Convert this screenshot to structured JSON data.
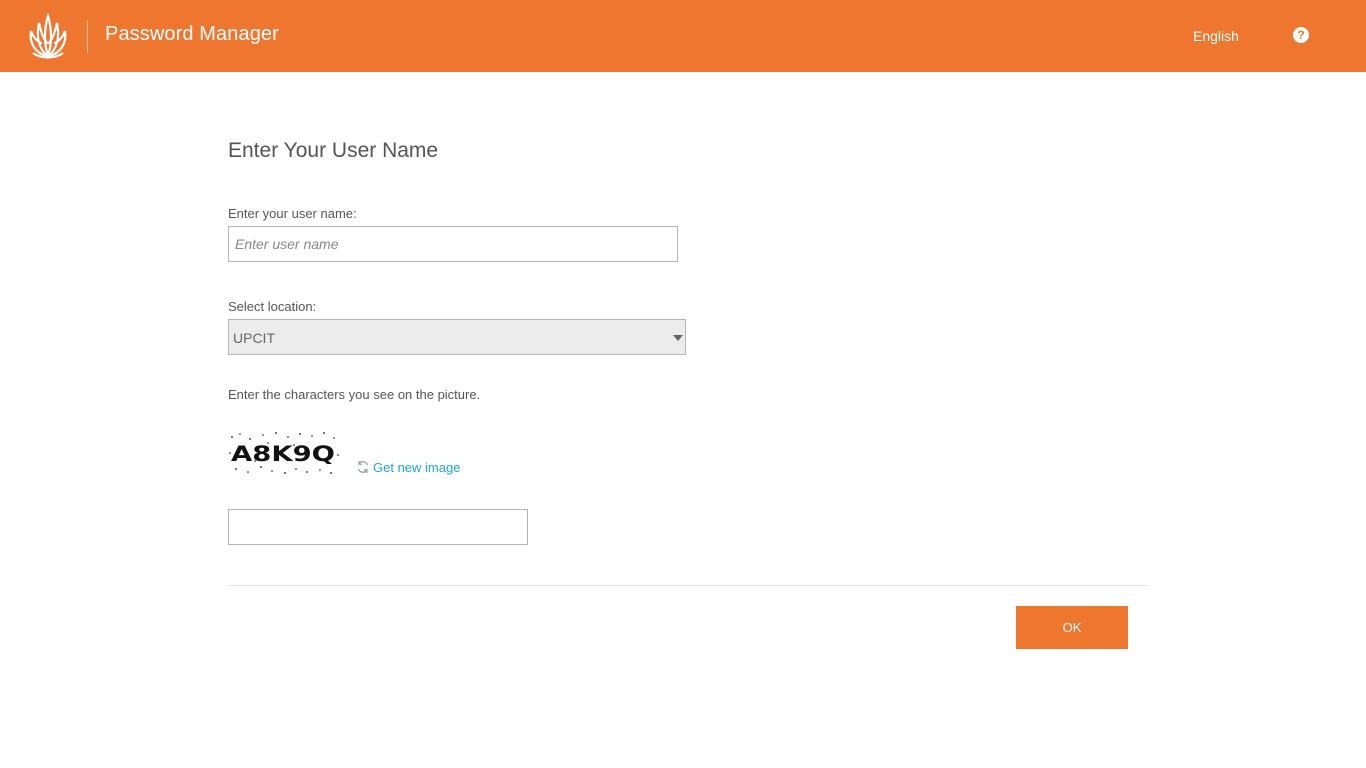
{
  "header": {
    "app_title": "Password Manager",
    "language": "English",
    "help_glyph": "?",
    "logo_icon": "company-logo-icon",
    "help_icon": "help-circle-icon",
    "background_color": "#ef762f"
  },
  "form": {
    "title": "Enter Your User Name",
    "username": {
      "label": "Enter your user name:",
      "placeholder": "Enter user name",
      "value": ""
    },
    "location": {
      "label": "Select location:",
      "selected": "UPCIT"
    },
    "captcha": {
      "instruction": "Enter the characters you see on the picture.",
      "image_text": "A8K9Q",
      "refresh_label": "Get new image",
      "refresh_icon": "refresh-icon",
      "value": ""
    },
    "ok_label": "OK"
  },
  "colors": {
    "accent": "#ef762f",
    "link": "#21a4d6"
  }
}
